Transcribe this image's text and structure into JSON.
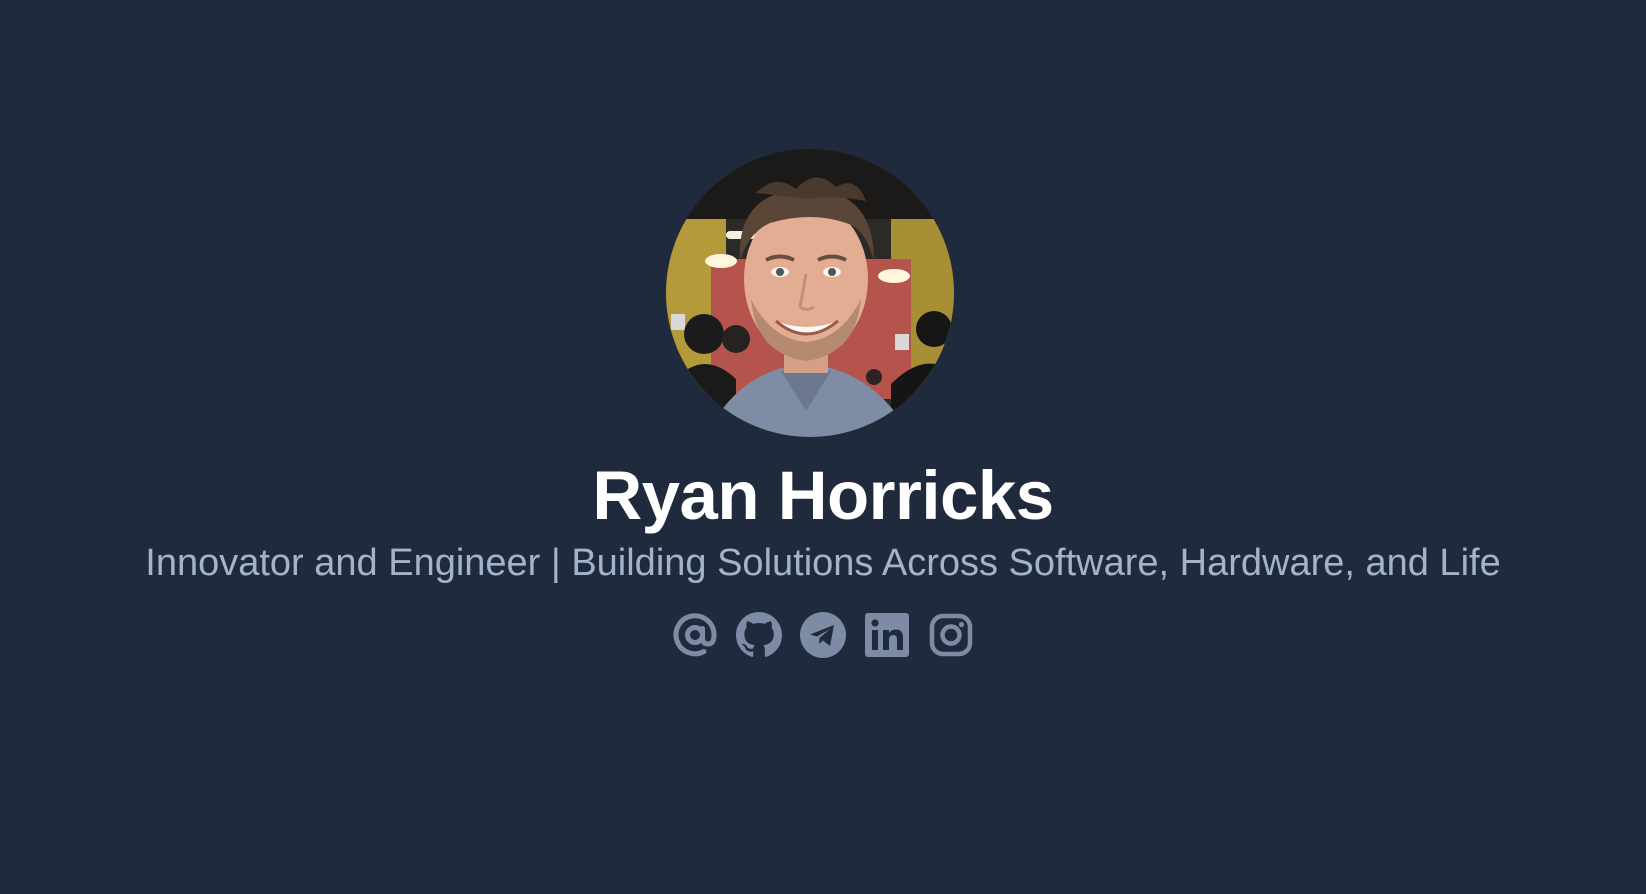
{
  "profile": {
    "avatar_alt": "Ryan Horricks",
    "name": "Ryan Horricks",
    "tagline": "Innovator and Engineer | Building Solutions Across Software, Hardware, and Life"
  },
  "social_links": [
    {
      "icon": "at-sign-icon",
      "label": "Email"
    },
    {
      "icon": "github-icon",
      "label": "GitHub"
    },
    {
      "icon": "telegram-icon",
      "label": "Telegram"
    },
    {
      "icon": "linkedin-icon",
      "label": "LinkedIn"
    },
    {
      "icon": "instagram-icon",
      "label": "Instagram"
    }
  ],
  "colors": {
    "background": "#1f2a3c",
    "name_text": "#ffffff",
    "tagline_text": "#a3b3cc",
    "icon_color": "#7d8ba5"
  }
}
